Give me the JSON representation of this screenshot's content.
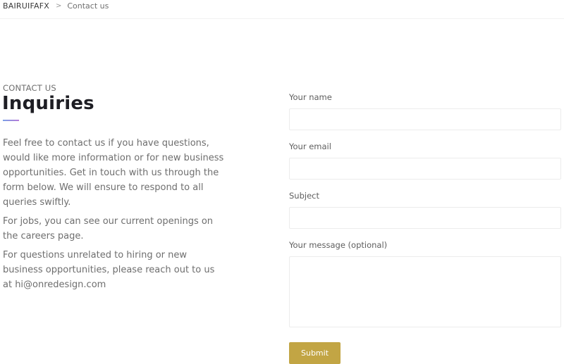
{
  "breadcrumb": {
    "home": "BAIRUIFAFX",
    "separator": ">",
    "current": "Contact us"
  },
  "intro": {
    "eyebrow": "CONTACT US",
    "title": "Inquiries",
    "paragraphs": [
      "Feel free to contact us if you have questions, would like more information or for new business opportunities. Get in touch with us through the form below. We will ensure to respond to all queries swiftly.",
      "For jobs, you can see our current openings on the careers page.",
      "For questions unrelated to hiring or new business opportunities, please reach out to us at hi@onredesign.com"
    ]
  },
  "form": {
    "name_label": "Your name",
    "name_value": "",
    "email_label": "Your email",
    "email_value": "",
    "subject_label": "Subject",
    "subject_value": "",
    "message_label": "Your message (optional)",
    "message_value": "",
    "submit_label": "Submit"
  },
  "colors": {
    "submit_background": "#c2a544",
    "title_text": "#1e1e24",
    "body_text": "#6e6e6e"
  }
}
